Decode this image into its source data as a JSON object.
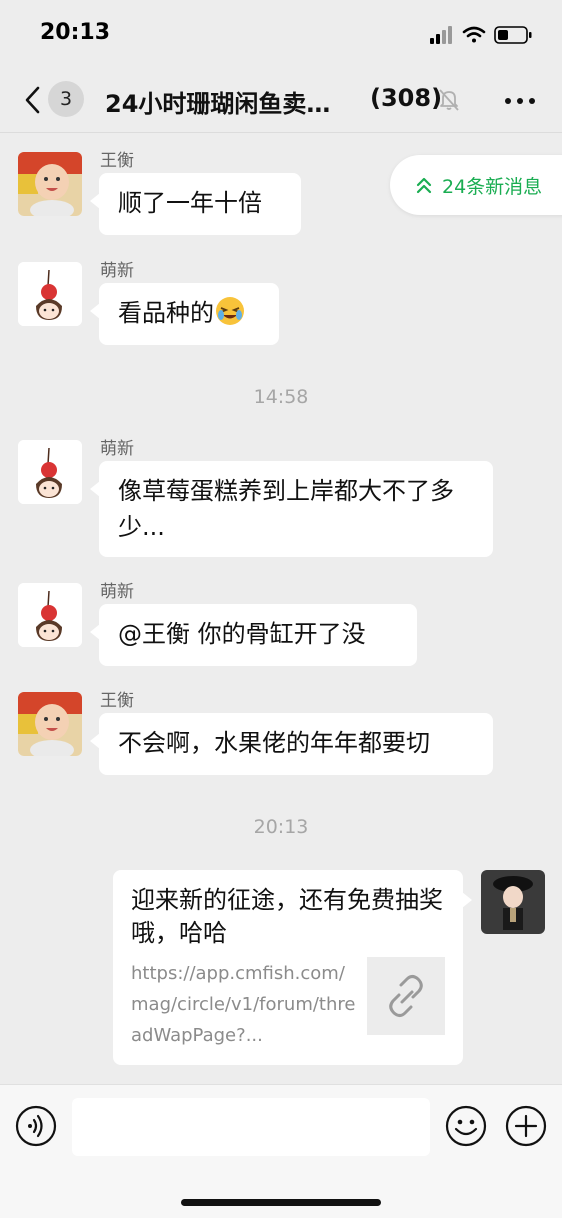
{
  "status_bar": {
    "time": "20:13"
  },
  "header": {
    "unread_count": "3",
    "title": "24小时珊瑚闲鱼卖…",
    "member_count": "(308)"
  },
  "new_messages_pill": {
    "label": "24条新消息"
  },
  "messages": [
    {
      "sender": "王衡",
      "text": "顺了一年十倍"
    },
    {
      "sender": "萌新",
      "text": "看品种的"
    },
    {
      "sender": "萌新",
      "text": "像草莓蛋糕养到上岸都大不了多少..."
    },
    {
      "sender": "萌新",
      "text": "@王衡 你的骨缸开了没"
    },
    {
      "sender": "王衡",
      "text": "不会啊，水果佬的年年都要切"
    }
  ],
  "timestamps": [
    "14:58",
    "20:13"
  ],
  "link_card": {
    "title": "迎来新的征途，还有免费抽奖哦，哈哈",
    "description": "https://app.cmfish.com/mag/circle/v1/forum/threadWapPage?..."
  },
  "input_bar": {
    "placeholder": ""
  },
  "colors": {
    "accent": "#1aad52",
    "background": "#ededed",
    "bubble": "#ffffff"
  },
  "icons": [
    "back-icon",
    "mute-icon",
    "more-icon",
    "chevrons-up-icon",
    "link-icon",
    "voice-icon",
    "emoji-icon",
    "plus-icon"
  ]
}
